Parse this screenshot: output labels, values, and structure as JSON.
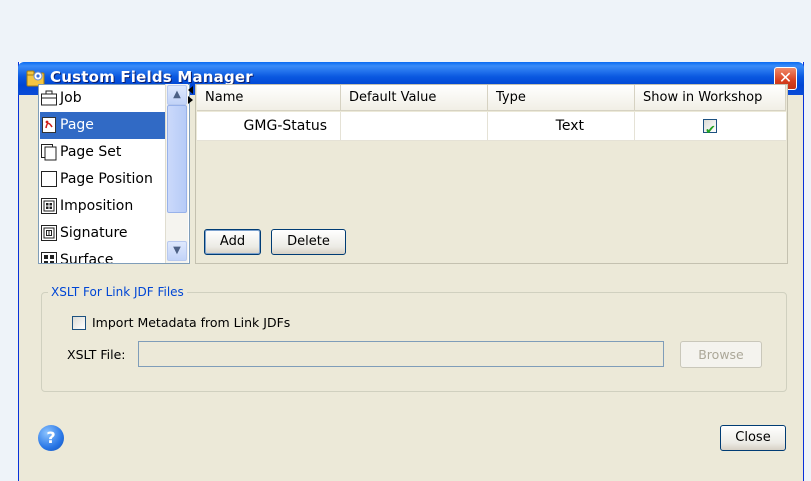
{
  "window": {
    "title": "Custom Fields Manager",
    "close_glyph": "✕",
    "title_icon": "folder-app-icon"
  },
  "object_list": {
    "items": [
      {
        "label": "Job",
        "icon": "job-icon"
      },
      {
        "label": "Page",
        "icon": "pdf-page-icon",
        "selected": true
      },
      {
        "label": "Page Set",
        "icon": "page-set-icon"
      },
      {
        "label": "Page Position",
        "icon": "page-position-icon"
      },
      {
        "label": "Imposition",
        "icon": "imposition-icon"
      },
      {
        "label": "Signature",
        "icon": "signature-icon"
      },
      {
        "label": "Surface",
        "icon": "surface-icon"
      }
    ],
    "scroll_up": "▲",
    "scroll_down": "▼"
  },
  "table": {
    "columns": [
      "Name",
      "Default Value",
      "Type",
      "Show in Workshop"
    ],
    "rows": [
      {
        "name": "GMG-Status",
        "default_value": "",
        "type": "Text",
        "show_in_workshop": "✔"
      }
    ]
  },
  "buttons": {
    "add": "Add",
    "delete": "Delete",
    "browse": "Browse",
    "close": "Close",
    "help": "?"
  },
  "xslt_group": {
    "title": "XSLT For Link JDF Files",
    "import_label": "Import Metadata from Link JDFs",
    "import_checked": false,
    "file_label": "XSLT File:",
    "file_value": ""
  },
  "colors": {
    "title_bar": "#0a58e0",
    "selection": "#316ac5",
    "group_title": "#0046d5",
    "checkmark": "#21a121"
  }
}
